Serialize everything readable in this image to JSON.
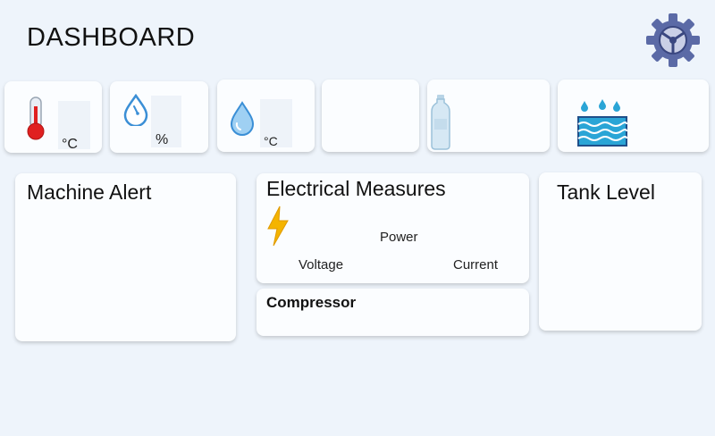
{
  "header": {
    "title": "DASHBOARD",
    "settings_icon": "gear-icon"
  },
  "sensor_tiles": [
    {
      "icon": "thermometer-icon",
      "unit": "°C"
    },
    {
      "icon": "humidity-drop-icon",
      "unit": "%"
    },
    {
      "icon": "water-drop-icon",
      "unit": "°C"
    },
    {
      "icon": "",
      "unit": ""
    },
    {
      "icon": "water-bottle-icon",
      "unit": ""
    },
    {
      "icon": "water-tank-icon",
      "unit": ""
    }
  ],
  "machine_alert": {
    "title": "Machine Alert"
  },
  "electrical": {
    "title": "Electrical Measures",
    "icon": "lightning-icon",
    "power_label": "Power",
    "voltage_label": "Voltage",
    "current_label": "Current"
  },
  "compressor": {
    "title": "Compressor"
  },
  "tank_level": {
    "title": "Tank Level"
  },
  "colors": {
    "background": "#eef4fb",
    "card": "#fbfdff",
    "gear": "#5b6aa6",
    "thermometer": "#e02020",
    "drop": "#3b8fd6",
    "lightning": "#f4b400",
    "water": "#2aa5d6"
  }
}
